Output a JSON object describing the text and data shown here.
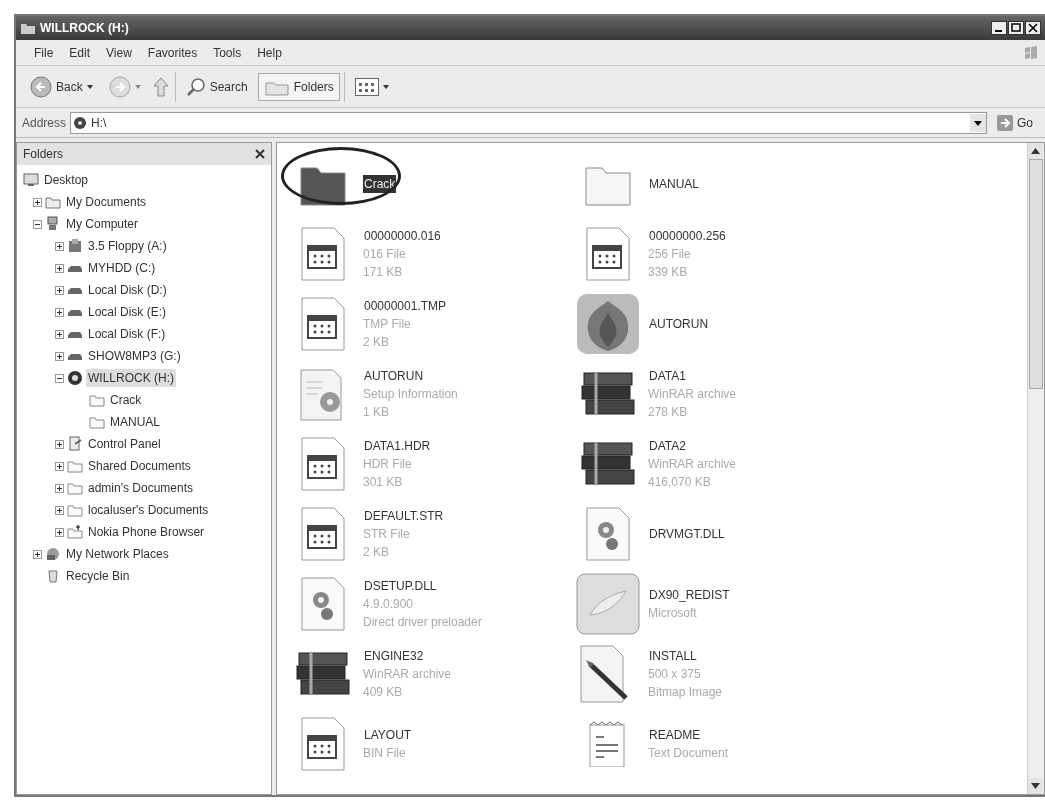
{
  "window": {
    "title": "WILLROCK (H:)"
  },
  "menu": [
    {
      "label": "File"
    },
    {
      "label": "Edit"
    },
    {
      "label": "View"
    },
    {
      "label": "Favorites"
    },
    {
      "label": "Tools"
    },
    {
      "label": "Help"
    }
  ],
  "toolbar": {
    "back": "Back",
    "search": "Search",
    "folders": {
      "label": "Folders",
      "selected": true
    }
  },
  "address": {
    "label": "Address",
    "value": "H:\\",
    "go": "Go"
  },
  "folders_pane": {
    "title": "Folders"
  },
  "tree": [
    {
      "label": "Desktop",
      "kind": "desktop",
      "selected": false,
      "children": [
        {
          "label": "My Documents",
          "kind": "documents",
          "expanded": false,
          "selected": false
        },
        {
          "label": "My Computer",
          "kind": "computer",
          "expanded": true,
          "selected": false,
          "children": [
            {
              "label": "3.5 Floppy (A:)",
              "kind": "floppy",
              "expanded": false,
              "selected": false
            },
            {
              "label": "MYHDD (C:)",
              "kind": "drive",
              "expanded": false,
              "selected": false
            },
            {
              "label": "Local Disk (D:)",
              "kind": "drive",
              "expanded": false,
              "selected": false
            },
            {
              "label": "Local Disk (E:)",
              "kind": "drive",
              "expanded": false,
              "selected": false
            },
            {
              "label": "Local Disk (F:)",
              "kind": "drive",
              "expanded": false,
              "selected": false
            },
            {
              "label": "SHOW8MP3 (G:)",
              "kind": "drive",
              "expanded": false,
              "selected": false
            },
            {
              "label": "WILLROCK (H:)",
              "kind": "disc",
              "expanded": true,
              "selected": true,
              "children": [
                {
                  "label": "Crack",
                  "kind": "folder",
                  "selected": false
                },
                {
                  "label": "MANUAL",
                  "kind": "folder",
                  "selected": false
                }
              ]
            },
            {
              "label": "Control Panel",
              "kind": "control",
              "expanded": false,
              "selected": false
            },
            {
              "label": "Shared Documents",
              "kind": "folder",
              "expanded": false,
              "selected": false
            },
            {
              "label": "admin's Documents",
              "kind": "folder",
              "expanded": false,
              "selected": false
            },
            {
              "label": "localuser's Documents",
              "kind": "folder",
              "expanded": false,
              "selected": false
            },
            {
              "label": "Nokia Phone Browser",
              "kind": "phone",
              "expanded": false,
              "selected": false
            }
          ]
        },
        {
          "label": "My Network Places",
          "kind": "network",
          "expanded": false,
          "selected": false
        },
        {
          "label": "Recycle Bin",
          "kind": "recycle",
          "selected": false
        }
      ]
    }
  ],
  "files": [
    {
      "name": "Crack",
      "kind": "folder",
      "selected": true,
      "circled": true
    },
    {
      "name": "MANUAL",
      "kind": "folder",
      "selected": false
    },
    {
      "name": "00000000.016",
      "kind": "generic",
      "selected": false,
      "details": [
        "016 File",
        "171 KB"
      ]
    },
    {
      "name": "00000000.256",
      "kind": "generic",
      "selected": false,
      "details": [
        "256 File",
        "339 KB"
      ]
    },
    {
      "name": "00000001.TMP",
      "kind": "generic",
      "selected": false,
      "details": [
        "TMP File",
        "2 KB"
      ]
    },
    {
      "name": "AUTORUN",
      "kind": "emblem",
      "selected": false
    },
    {
      "name": "AUTORUN",
      "kind": "setup",
      "selected": false,
      "details": [
        "Setup Information",
        "1 KB"
      ]
    },
    {
      "name": "DATA1",
      "kind": "archive",
      "selected": false,
      "details": [
        "WinRAR archive",
        "278 KB"
      ]
    },
    {
      "name": "DATA1.HDR",
      "kind": "generic",
      "selected": false,
      "details": [
        "HDR File",
        "301 KB"
      ]
    },
    {
      "name": "DATA2",
      "kind": "archive",
      "selected": false,
      "details": [
        "WinRAR archive",
        "416,070 KB"
      ]
    },
    {
      "name": "DEFAULT.STR",
      "kind": "generic",
      "selected": false,
      "details": [
        "STR File",
        "2 KB"
      ]
    },
    {
      "name": "DRVMGT.DLL",
      "kind": "dll",
      "selected": false
    },
    {
      "name": "DSETUP.DLL",
      "kind": "dll",
      "selected": false,
      "details": [
        "4.9.0.900",
        "Direct driver preloader"
      ]
    },
    {
      "name": "DX90_REDIST",
      "kind": "installer",
      "selected": false,
      "details": [
        "Microsoft"
      ]
    },
    {
      "name": "ENGINE32",
      "kind": "archive",
      "selected": false,
      "details": [
        "WinRAR archive",
        "409 KB"
      ]
    },
    {
      "name": "INSTALL",
      "kind": "bitmap",
      "selected": false,
      "details": [
        "500 x 375",
        "Bitmap Image"
      ]
    },
    {
      "name": "LAYOUT",
      "kind": "generic",
      "selected": false,
      "details": [
        "BIN File"
      ]
    },
    {
      "name": "README",
      "kind": "text",
      "selected": false,
      "details": [
        "Text Document"
      ]
    }
  ]
}
